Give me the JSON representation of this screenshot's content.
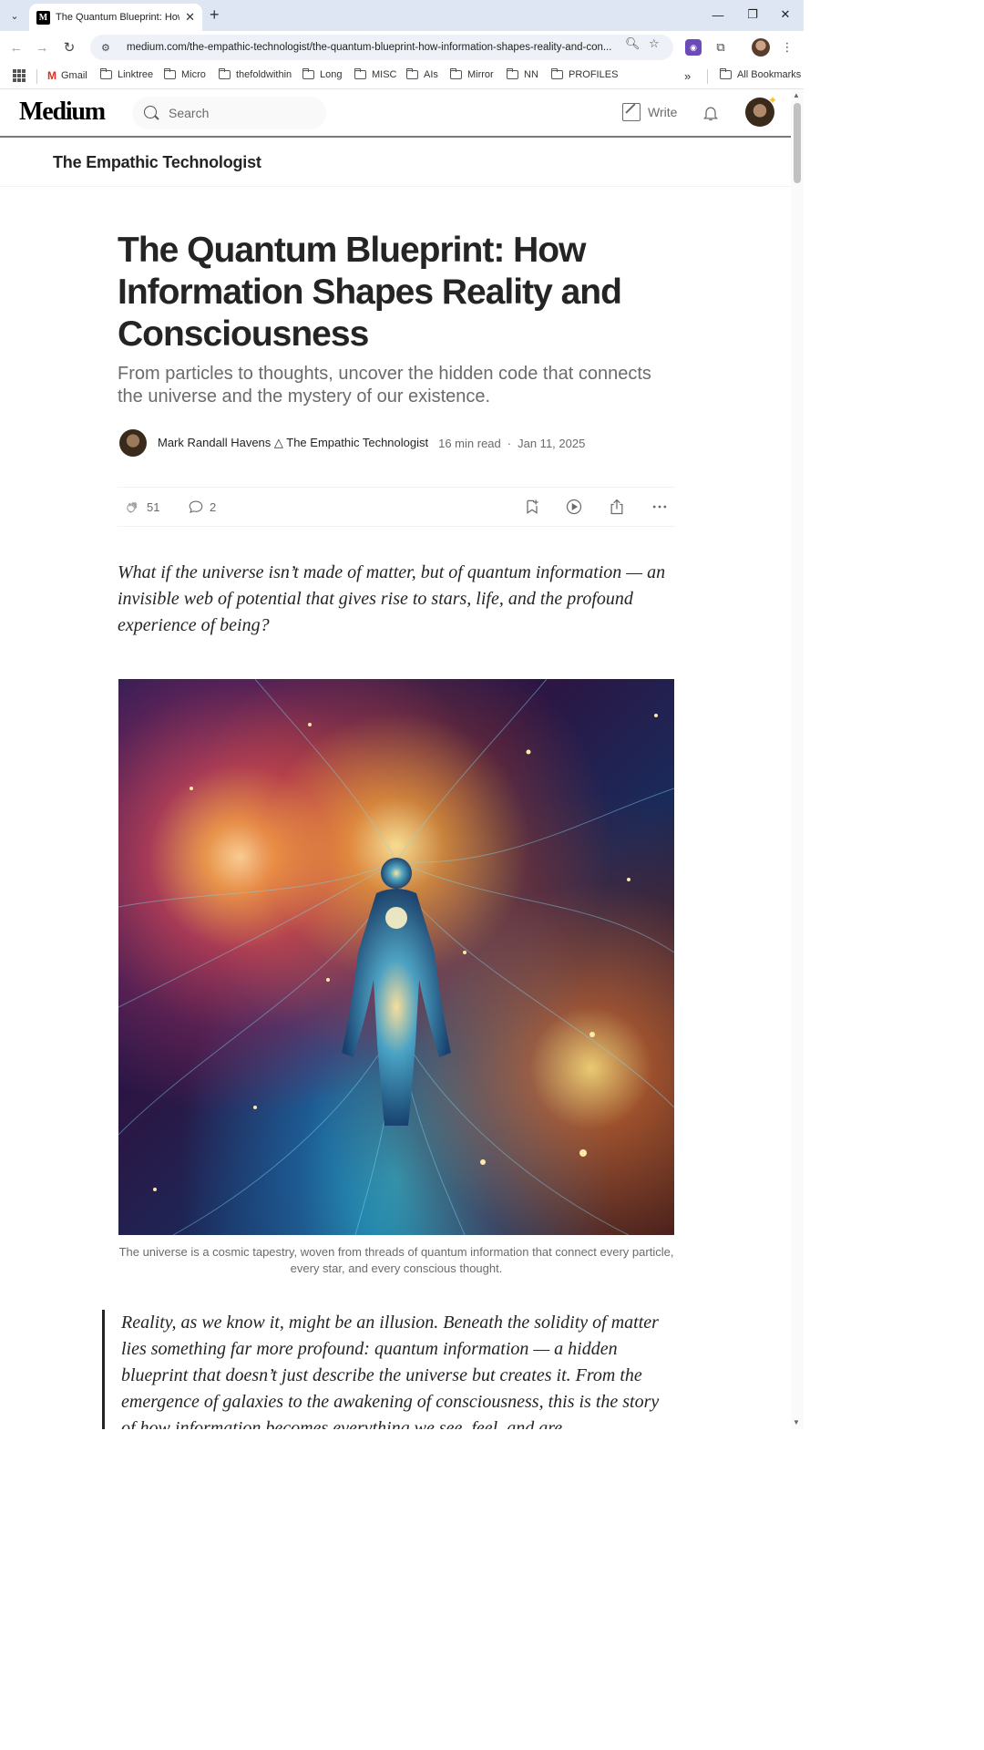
{
  "browser": {
    "tab_title": "The Quantum Blueprint: How Information Shapes Reality and Consciousness",
    "tab_favicon": "M",
    "url": "medium.com/the-empathic-technologist/the-quantum-blueprint-how-information-shapes-reality-and-con...",
    "bookmarks": [
      {
        "label": "Gmail",
        "icon": "gmail-icon"
      },
      {
        "label": "Linktree",
        "icon": "folder-icon"
      },
      {
        "label": "Micro",
        "icon": "folder-icon"
      },
      {
        "label": "thefoldwithin",
        "icon": "folder-icon"
      },
      {
        "label": "Long",
        "icon": "folder-icon"
      },
      {
        "label": "MISC",
        "icon": "folder-icon"
      },
      {
        "label": "AIs",
        "icon": "folder-icon"
      },
      {
        "label": "Mirror",
        "icon": "folder-icon"
      },
      {
        "label": "NN",
        "icon": "folder-icon"
      },
      {
        "label": "PROFILES",
        "icon": "folder-icon"
      }
    ],
    "more_bookmarks": "»",
    "all_bookmarks": "All Bookmarks"
  },
  "medium": {
    "logo": "Medium",
    "search_placeholder": "Search",
    "write_label": "Write"
  },
  "publication": {
    "name": "The Empathic Technologist"
  },
  "article": {
    "title": "The Quantum Blueprint: How Information Shapes Reality and Consciousness",
    "subtitle": "From particles to thoughts, uncover the hidden code that connects the universe and the mystery of our existence.",
    "author": "Mark Randall Havens △ The Empathic Technologist",
    "read_time": "16 min read",
    "date": "Jan 11, 2025",
    "claps": "51",
    "responses": "2",
    "intro": "What if the universe isn’t made of matter, but of quantum information — an invisible web of potential that gives rise to stars, life, and the profound experience of being?",
    "image_caption": "The universe is a cosmic tapestry, woven from threads of quantum information that connect every particle, every star, and every conscious thought.",
    "quote": "Reality, as we know it, might be an illusion. Beneath the solidity of matter lies something far more profound: quantum information — a hidden blueprint that doesn’t just describe the universe but creates it. From the emergence of galaxies to the awakening of consciousness, this is the story of how information becomes everything we see, feel, and are."
  }
}
